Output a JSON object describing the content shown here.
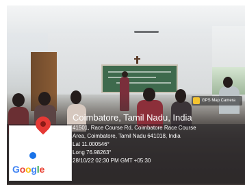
{
  "gps_camera_badge": {
    "label": "GPS Map Camera"
  },
  "location": {
    "title": "Coimbatore, Tamil Nadu, India",
    "address_line_1": "41501, Race Course Rd, Coimbatore Race Course",
    "address_line_2": "Area, Coimbatore, Tamil Nadu 641018, India",
    "latitude": "Lat 11.000546°",
    "longitude": "Long 76.98263°",
    "timestamp": "28/10/22 02:30 PM GMT +05:30"
  },
  "map_thumbnail": {
    "logo_letters": [
      "G",
      "o",
      "o",
      "g",
      "l",
      "e"
    ],
    "pin_color": "#e53935"
  },
  "colors": {
    "overlay_text": "#ffffff",
    "google_blue": "#4285f4",
    "google_red": "#ea4335",
    "google_yellow": "#fbbc05",
    "google_green": "#34a853"
  }
}
